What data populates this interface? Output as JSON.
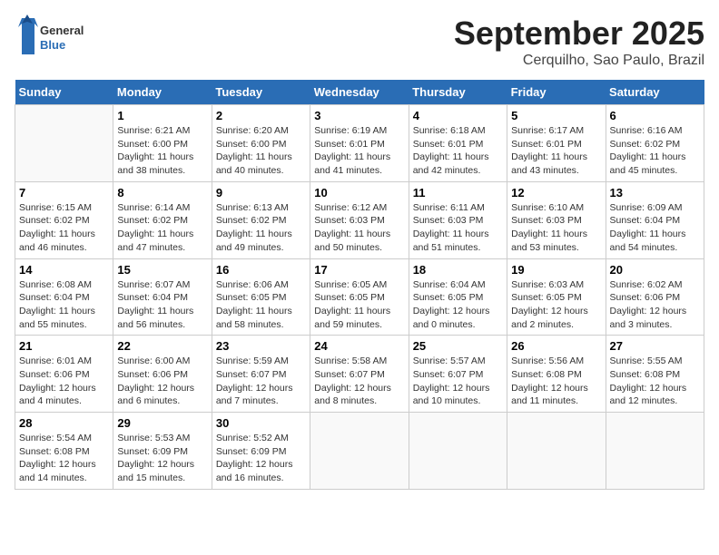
{
  "header": {
    "logo_general": "General",
    "logo_blue": "Blue",
    "month_title": "September 2025",
    "location": "Cerquilho, Sao Paulo, Brazil"
  },
  "columns": [
    "Sunday",
    "Monday",
    "Tuesday",
    "Wednesday",
    "Thursday",
    "Friday",
    "Saturday"
  ],
  "weeks": [
    [
      {
        "day": "",
        "info": ""
      },
      {
        "day": "1",
        "info": "Sunrise: 6:21 AM\nSunset: 6:00 PM\nDaylight: 11 hours\nand 38 minutes."
      },
      {
        "day": "2",
        "info": "Sunrise: 6:20 AM\nSunset: 6:00 PM\nDaylight: 11 hours\nand 40 minutes."
      },
      {
        "day": "3",
        "info": "Sunrise: 6:19 AM\nSunset: 6:01 PM\nDaylight: 11 hours\nand 41 minutes."
      },
      {
        "day": "4",
        "info": "Sunrise: 6:18 AM\nSunset: 6:01 PM\nDaylight: 11 hours\nand 42 minutes."
      },
      {
        "day": "5",
        "info": "Sunrise: 6:17 AM\nSunset: 6:01 PM\nDaylight: 11 hours\nand 43 minutes."
      },
      {
        "day": "6",
        "info": "Sunrise: 6:16 AM\nSunset: 6:02 PM\nDaylight: 11 hours\nand 45 minutes."
      }
    ],
    [
      {
        "day": "7",
        "info": "Sunrise: 6:15 AM\nSunset: 6:02 PM\nDaylight: 11 hours\nand 46 minutes."
      },
      {
        "day": "8",
        "info": "Sunrise: 6:14 AM\nSunset: 6:02 PM\nDaylight: 11 hours\nand 47 minutes."
      },
      {
        "day": "9",
        "info": "Sunrise: 6:13 AM\nSunset: 6:02 PM\nDaylight: 11 hours\nand 49 minutes."
      },
      {
        "day": "10",
        "info": "Sunrise: 6:12 AM\nSunset: 6:03 PM\nDaylight: 11 hours\nand 50 minutes."
      },
      {
        "day": "11",
        "info": "Sunrise: 6:11 AM\nSunset: 6:03 PM\nDaylight: 11 hours\nand 51 minutes."
      },
      {
        "day": "12",
        "info": "Sunrise: 6:10 AM\nSunset: 6:03 PM\nDaylight: 11 hours\nand 53 minutes."
      },
      {
        "day": "13",
        "info": "Sunrise: 6:09 AM\nSunset: 6:04 PM\nDaylight: 11 hours\nand 54 minutes."
      }
    ],
    [
      {
        "day": "14",
        "info": "Sunrise: 6:08 AM\nSunset: 6:04 PM\nDaylight: 11 hours\nand 55 minutes."
      },
      {
        "day": "15",
        "info": "Sunrise: 6:07 AM\nSunset: 6:04 PM\nDaylight: 11 hours\nand 56 minutes."
      },
      {
        "day": "16",
        "info": "Sunrise: 6:06 AM\nSunset: 6:05 PM\nDaylight: 11 hours\nand 58 minutes."
      },
      {
        "day": "17",
        "info": "Sunrise: 6:05 AM\nSunset: 6:05 PM\nDaylight: 11 hours\nand 59 minutes."
      },
      {
        "day": "18",
        "info": "Sunrise: 6:04 AM\nSunset: 6:05 PM\nDaylight: 12 hours\nand 0 minutes."
      },
      {
        "day": "19",
        "info": "Sunrise: 6:03 AM\nSunset: 6:05 PM\nDaylight: 12 hours\nand 2 minutes."
      },
      {
        "day": "20",
        "info": "Sunrise: 6:02 AM\nSunset: 6:06 PM\nDaylight: 12 hours\nand 3 minutes."
      }
    ],
    [
      {
        "day": "21",
        "info": "Sunrise: 6:01 AM\nSunset: 6:06 PM\nDaylight: 12 hours\nand 4 minutes."
      },
      {
        "day": "22",
        "info": "Sunrise: 6:00 AM\nSunset: 6:06 PM\nDaylight: 12 hours\nand 6 minutes."
      },
      {
        "day": "23",
        "info": "Sunrise: 5:59 AM\nSunset: 6:07 PM\nDaylight: 12 hours\nand 7 minutes."
      },
      {
        "day": "24",
        "info": "Sunrise: 5:58 AM\nSunset: 6:07 PM\nDaylight: 12 hours\nand 8 minutes."
      },
      {
        "day": "25",
        "info": "Sunrise: 5:57 AM\nSunset: 6:07 PM\nDaylight: 12 hours\nand 10 minutes."
      },
      {
        "day": "26",
        "info": "Sunrise: 5:56 AM\nSunset: 6:08 PM\nDaylight: 12 hours\nand 11 minutes."
      },
      {
        "day": "27",
        "info": "Sunrise: 5:55 AM\nSunset: 6:08 PM\nDaylight: 12 hours\nand 12 minutes."
      }
    ],
    [
      {
        "day": "28",
        "info": "Sunrise: 5:54 AM\nSunset: 6:08 PM\nDaylight: 12 hours\nand 14 minutes."
      },
      {
        "day": "29",
        "info": "Sunrise: 5:53 AM\nSunset: 6:09 PM\nDaylight: 12 hours\nand 15 minutes."
      },
      {
        "day": "30",
        "info": "Sunrise: 5:52 AM\nSunset: 6:09 PM\nDaylight: 12 hours\nand 16 minutes."
      },
      {
        "day": "",
        "info": ""
      },
      {
        "day": "",
        "info": ""
      },
      {
        "day": "",
        "info": ""
      },
      {
        "day": "",
        "info": ""
      }
    ]
  ]
}
